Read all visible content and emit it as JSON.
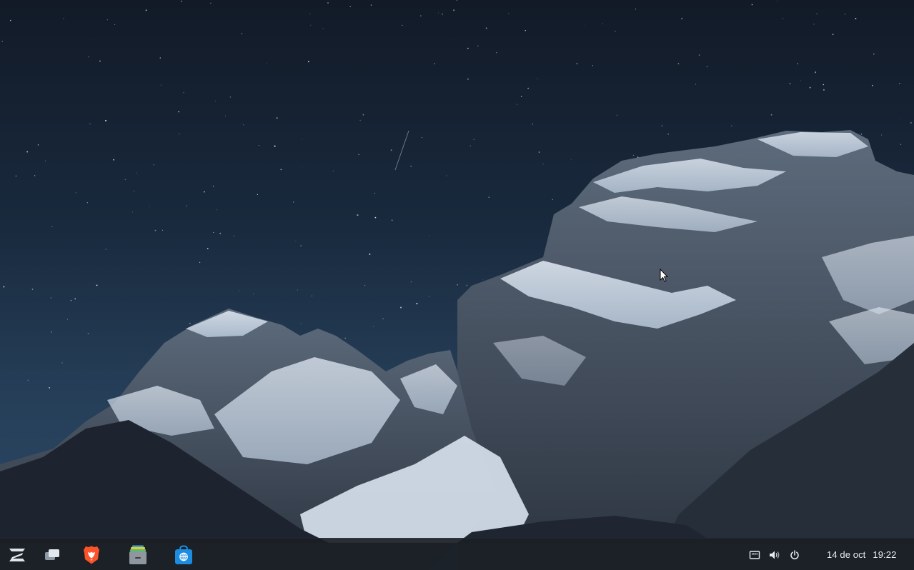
{
  "desktop": {
    "wallpaper": "night-mountain-stars"
  },
  "taskbar": {
    "launchers": [
      {
        "name": "zorin-menu",
        "icon": "zorin-logo-icon"
      },
      {
        "name": "workspaces",
        "icon": "workspaces-icon"
      },
      {
        "name": "brave-browser",
        "icon": "brave-lion-icon"
      },
      {
        "name": "files",
        "icon": "file-cabinet-icon"
      },
      {
        "name": "software-store",
        "icon": "store-bag-icon"
      }
    ],
    "tray": {
      "icons": [
        "network-wired-icon",
        "volume-icon",
        "power-icon"
      ],
      "date": "14 de oct",
      "time": "19:22"
    }
  },
  "colors": {
    "taskbar_bg": "#1b1f25",
    "text": "#e8eaed",
    "brave": "#fb542b",
    "store": "#1c8ce0"
  }
}
